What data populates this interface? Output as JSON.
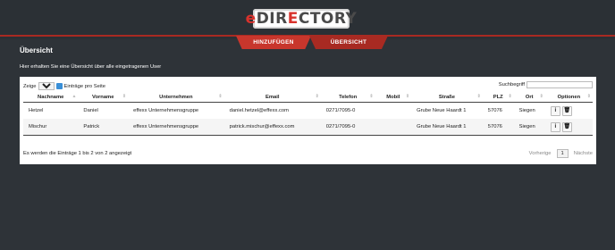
{
  "logo": {
    "part1": "e",
    "part2": "DIR",
    "part3": "E",
    "part4": "CTORY"
  },
  "tabs": [
    {
      "label": "HINZUFÜGEN"
    },
    {
      "label": "ÜBERSICHT"
    }
  ],
  "page": {
    "title": "Übersicht",
    "subtitle": "Hier erhalten Sie eine Übersicht über alle eingetragenen User"
  },
  "controls": {
    "show_prefix": "Zeige",
    "page_size": "10",
    "show_suffix": "Einträge pro Seite",
    "search_label": "Suchbegriff",
    "search_value": ""
  },
  "table": {
    "columns": [
      "Nachname",
      "Vorname",
      "Unternehmen",
      "Email",
      "Telefon",
      "Mobil",
      "Straße",
      "PLZ",
      "Ort",
      "Optionen"
    ],
    "rows": [
      {
        "nachname": "Hetzel",
        "vorname": "Daniel",
        "unternehmen": "effexx Unternehmensgruppe",
        "email": "daniel.hetzel@effexx.com",
        "telefon": "0271/7095-0",
        "mobil": "",
        "strasse": "Grube Neue Haardt 1",
        "plz": "57076",
        "ort": "Siegen"
      },
      {
        "nachname": "Mischur",
        "vorname": "Patrick",
        "unternehmen": "effexx Unternehmensgruppe",
        "email": "patrick.mischur@effexx.com",
        "telefon": "0271/7095-0",
        "mobil": "",
        "strasse": "Grube Neue Haardt 1",
        "plz": "57076",
        "ort": "Siegen"
      }
    ]
  },
  "footer": {
    "info": "Es werden die Einträge 1 bis 2 von 2 angezeigt",
    "prev": "Vorherige",
    "page": "1",
    "next": "Nächste"
  },
  "icons": {
    "info": "info-icon",
    "delete": "trash-icon"
  },
  "colors": {
    "background": "#2e3338",
    "accent": "#c8362c",
    "accent_dark": "#a82a22"
  }
}
